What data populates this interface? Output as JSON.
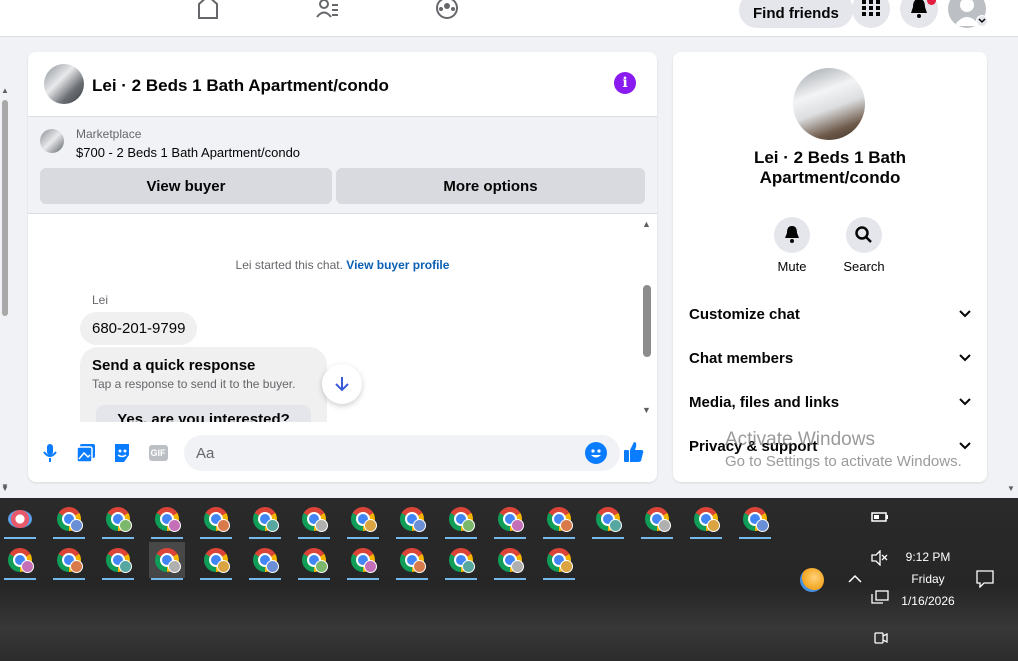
{
  "topnav": {
    "find_friends": "Find friends"
  },
  "chat": {
    "title": "Lei · 2 Beds 1 Bath Apartment/condo",
    "marketplace_label": "Marketplace",
    "listing": "$700 - 2 Beds 1 Bath Apartment/condo",
    "view_buyer": "View buyer",
    "more_options": "More options",
    "system_message": "Lei started this chat.",
    "view_buyer_profile": "View buyer profile",
    "sender": "Lei",
    "message": "680-201-9799",
    "quick_title": "Send a quick response",
    "quick_sub": "Tap a response to send it to the buyer.",
    "quick_option": "Yes, are you interested?",
    "input_placeholder": "Aa",
    "gif_label": "GIF"
  },
  "info": {
    "name_line1": "Lei · 2 Beds 1 Bath",
    "name_line2": "Apartment/condo",
    "mute": "Mute",
    "search": "Search",
    "sections": [
      "Customize chat",
      "Chat members",
      "Media, files and links",
      "Privacy & support"
    ]
  },
  "watermark": {
    "line1": "Activate Windows",
    "line2": "Go to Settings to activate Windows."
  },
  "tray": {
    "time": "9:12 PM",
    "day": "Friday",
    "date": "1/16/2026"
  },
  "colors": {
    "accent": "#0a7cff",
    "info_button": "#8a1bf0",
    "link": "#0a5fb4"
  }
}
